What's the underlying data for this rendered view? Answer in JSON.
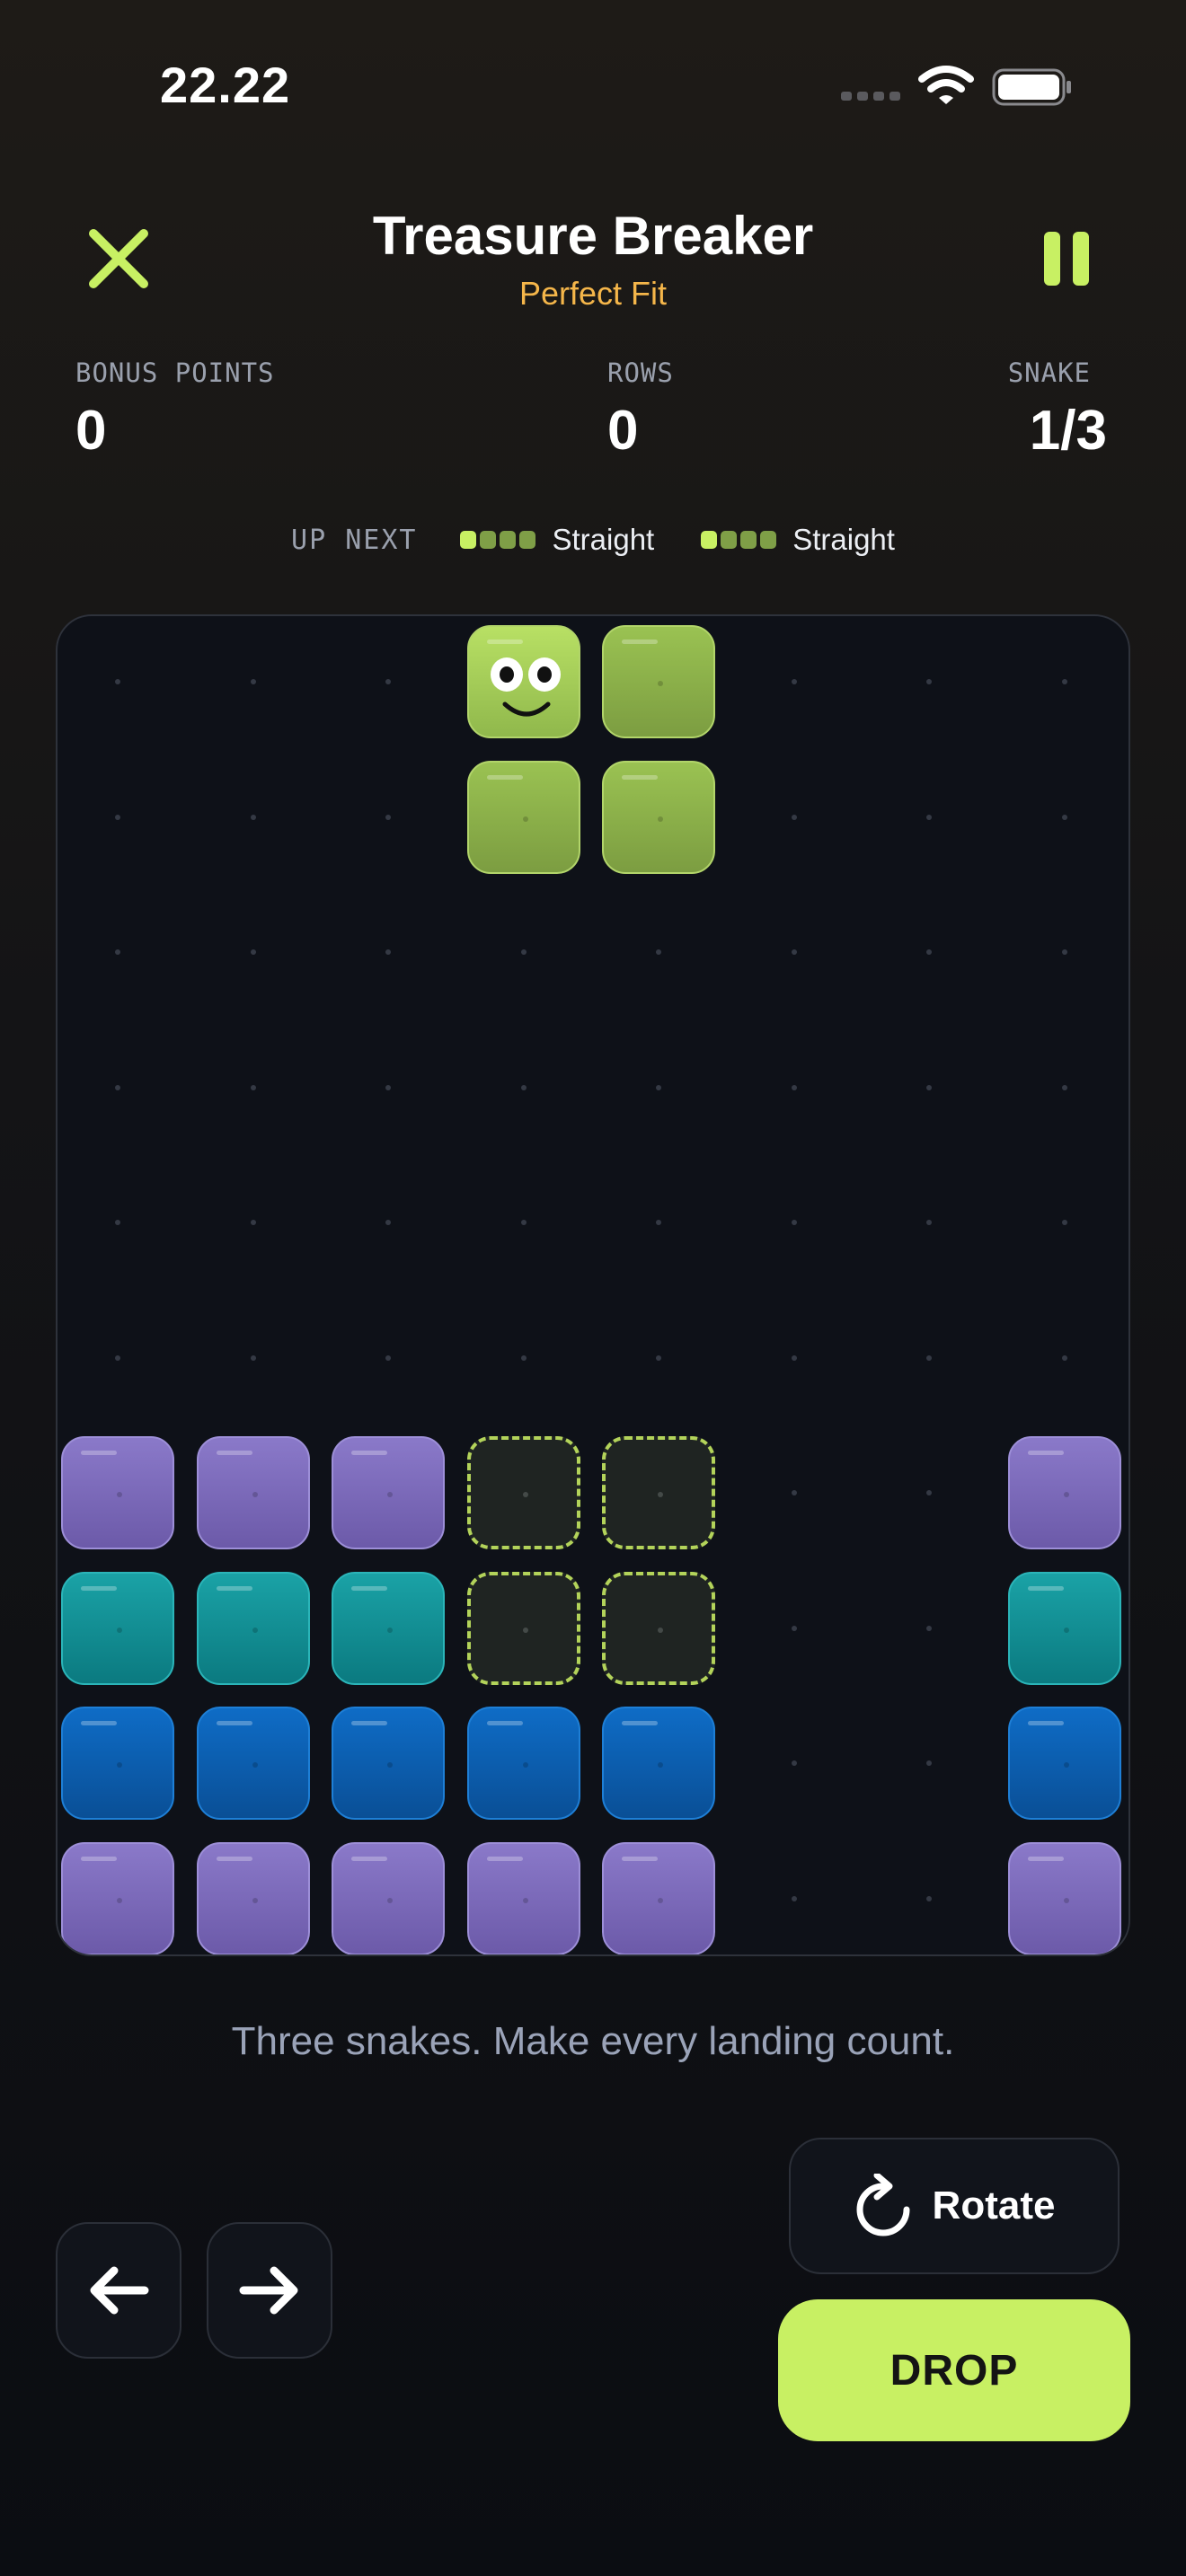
{
  "status_bar": {
    "time": "22.22"
  },
  "header": {
    "title": "Treasure Breaker",
    "subtitle": "Perfect Fit"
  },
  "stats": [
    {
      "label": "BONUS POINTS",
      "value": "0"
    },
    {
      "label": "ROWS",
      "value": "0"
    },
    {
      "label": "SNAKE",
      "value": "1/3"
    }
  ],
  "up_next": {
    "label": "UP NEXT",
    "items": [
      {
        "name": "Straight",
        "segments": 4
      },
      {
        "name": "Straight",
        "segments": 4
      }
    ]
  },
  "board": {
    "columns": 8,
    "rows": 10,
    "grid": [
      [
        "",
        "",
        "",
        "H",
        "S",
        "",
        "",
        ""
      ],
      [
        "",
        "",
        "",
        "S",
        "S",
        "",
        "",
        ""
      ],
      [
        "",
        "",
        "",
        "",
        "",
        "",
        "",
        ""
      ],
      [
        "",
        "",
        "",
        "",
        "",
        "",
        "",
        ""
      ],
      [
        "",
        "",
        "",
        "",
        "",
        "",
        "",
        ""
      ],
      [
        "",
        "",
        "",
        "",
        "",
        "",
        "",
        ""
      ],
      [
        "P",
        "P",
        "P",
        "G",
        "G",
        "",
        "",
        "P"
      ],
      [
        "T",
        "T",
        "T",
        "G",
        "G",
        "",
        "",
        "T"
      ],
      [
        "B",
        "B",
        "B",
        "B",
        "B",
        "",
        "",
        "B"
      ],
      [
        "P",
        "P",
        "P",
        "P",
        "P",
        "",
        "",
        "P"
      ]
    ],
    "legend": {
      "H": "snake-head",
      "S": "snake-body",
      "G": "drop-ghost",
      "P": "purple-block",
      "T": "teal-block",
      "B": "blue-block"
    },
    "colors": {
      "snake": "#9ac252",
      "ghost_outline": "#b3d35a",
      "purple": "#7a68b8",
      "teal": "#0f8f95",
      "blue": "#0c5eae"
    }
  },
  "hint": "Three snakes. Make every landing count.",
  "controls": {
    "left_icon": "arrow-left-icon",
    "right_icon": "arrow-right-icon",
    "rotate_icon": "rotate-icon",
    "rotate_label": "Rotate",
    "drop_label": "DROP"
  },
  "accent_color": "#c8f063"
}
